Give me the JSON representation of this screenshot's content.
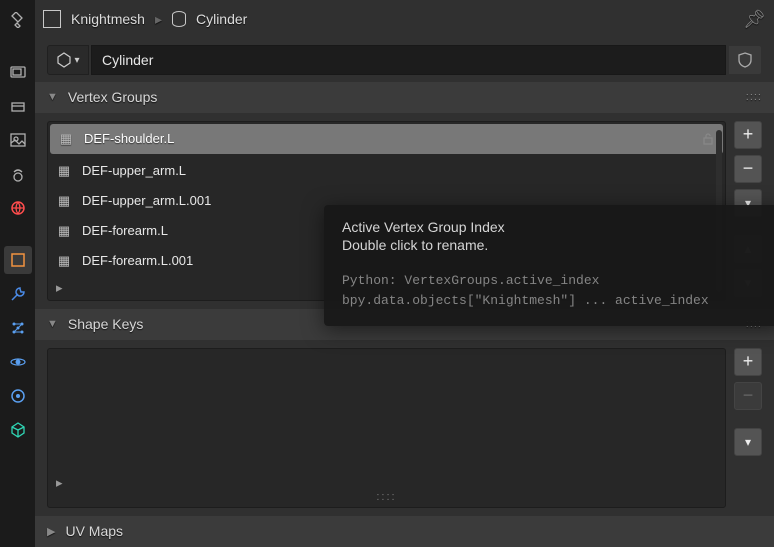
{
  "breadcrumb": {
    "object": "Knightmesh",
    "mesh": "Cylinder"
  },
  "object_name": "Cylinder",
  "panels": {
    "vertex_groups": {
      "title": "Vertex Groups"
    },
    "shape_keys": {
      "title": "Shape Keys"
    },
    "uv_maps": {
      "title": "UV Maps"
    }
  },
  "vertex_groups": [
    {
      "name": "DEF-shoulder.L",
      "selected": true
    },
    {
      "name": "DEF-upper_arm.L",
      "selected": false
    },
    {
      "name": "DEF-upper_arm.L.001",
      "selected": false
    },
    {
      "name": "DEF-forearm.L",
      "selected": false
    },
    {
      "name": "DEF-forearm.L.001",
      "selected": false
    }
  ],
  "tooltip": {
    "title": "Active Vertex Group Index",
    "subtitle": "Double click to rename.",
    "python_label": "Python: VertexGroups.active_index",
    "python_path": "bpy.data.objects[\"Knightmesh\"] ... active_index"
  },
  "chart_data": {
    "type": "table",
    "title": "Vertex Groups",
    "rows": [
      "DEF-shoulder.L",
      "DEF-upper_arm.L",
      "DEF-upper_arm.L.001",
      "DEF-forearm.L",
      "DEF-forearm.L.001"
    ]
  }
}
